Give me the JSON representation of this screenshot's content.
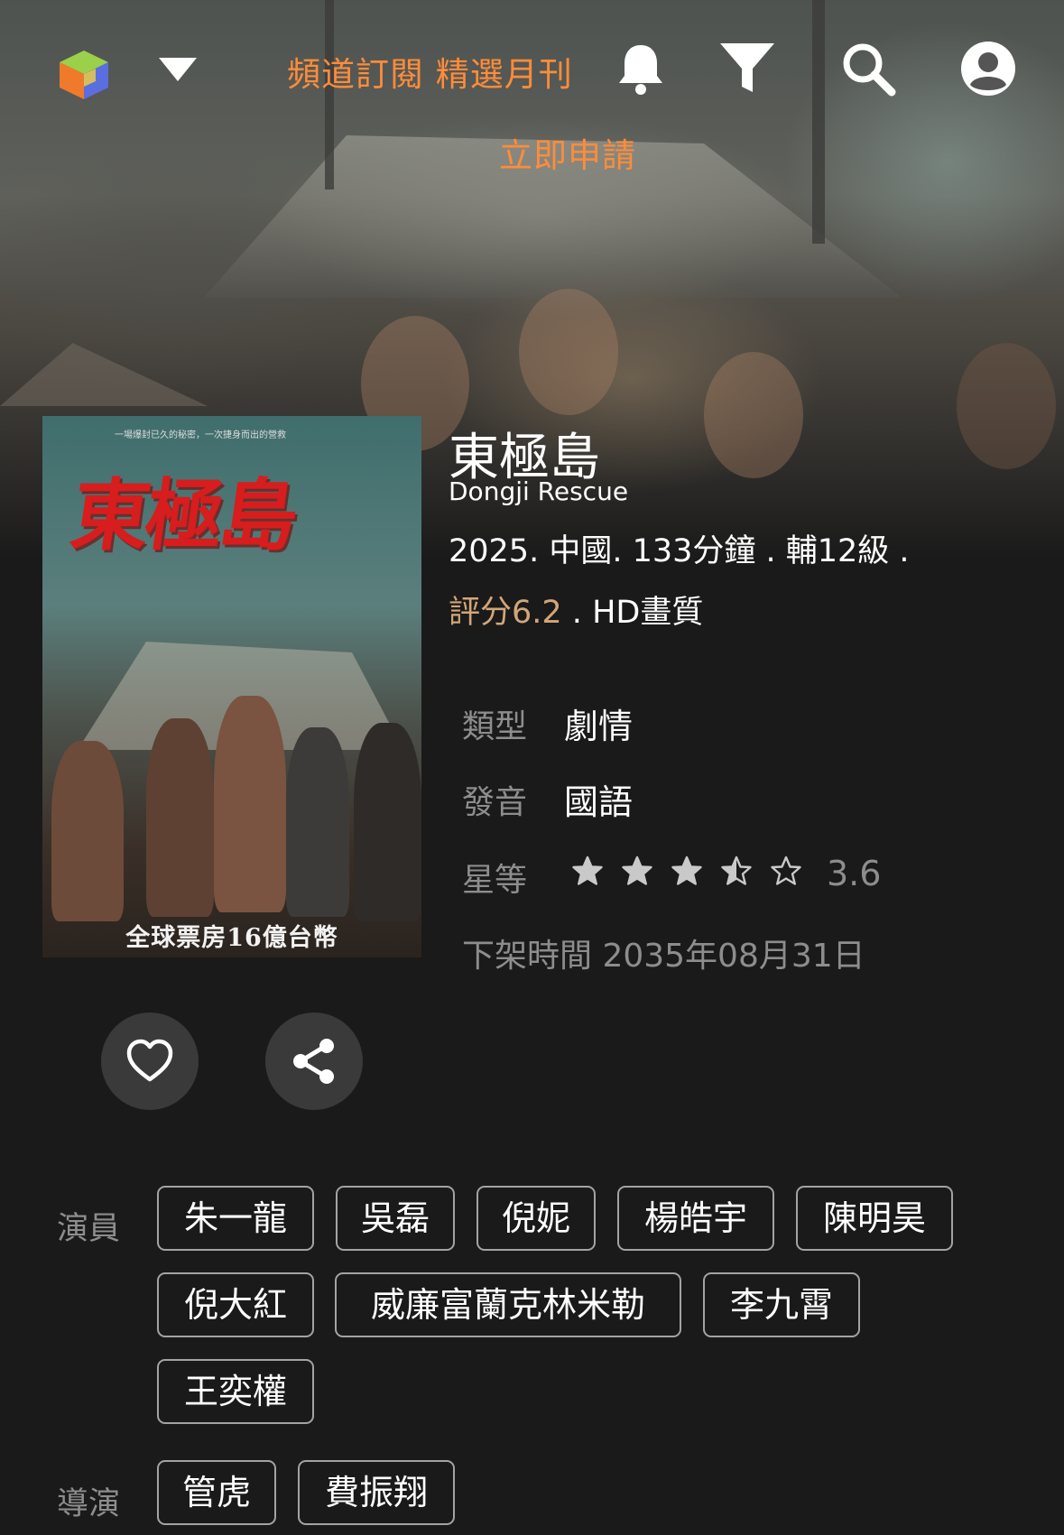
{
  "header": {
    "logo_icon": "colored-cube-icon",
    "menu_icon": "caret-down-icon",
    "promo_line1": "頻道訂閱 精選月刊",
    "promo_line2": "立即申請",
    "promo_color": "#ff8c3a",
    "icons": [
      "bell-icon",
      "filter-icon",
      "search-icon",
      "account-icon"
    ]
  },
  "poster": {
    "title_art": "東極島",
    "tagline": "一場爆封已久的秘密，一次捷身而出的營救",
    "caption": "全球票房16億台幣"
  },
  "movie": {
    "title": "東極島",
    "subtitle": "Dongji Rescue",
    "meta_line": "2025.  中國.  133分鐘 .  輔12級 .",
    "score": "評分6.2",
    "score_sep": " .  ",
    "quality": "HD畫質",
    "genre_label": "類型",
    "genre": "劇情",
    "audio_label": "發音",
    "audio": "國語",
    "stars_label": "星等",
    "star_rating": 3.6,
    "star_rating_text": "3.6",
    "expiry": "下架時間 2035年08月31日"
  },
  "actions": {
    "favorite_icon": "heart-icon",
    "share_icon": "share-icon"
  },
  "credits": {
    "cast_label": "演員",
    "cast": [
      "朱一龍",
      "吳磊",
      "倪妮",
      "楊皓宇",
      "陳明昊",
      "倪大紅",
      "威廉富蘭克林米勒",
      "李九霄",
      "王奕權"
    ],
    "director_label": "導演",
    "directors": [
      "管虎",
      "費振翔"
    ]
  }
}
